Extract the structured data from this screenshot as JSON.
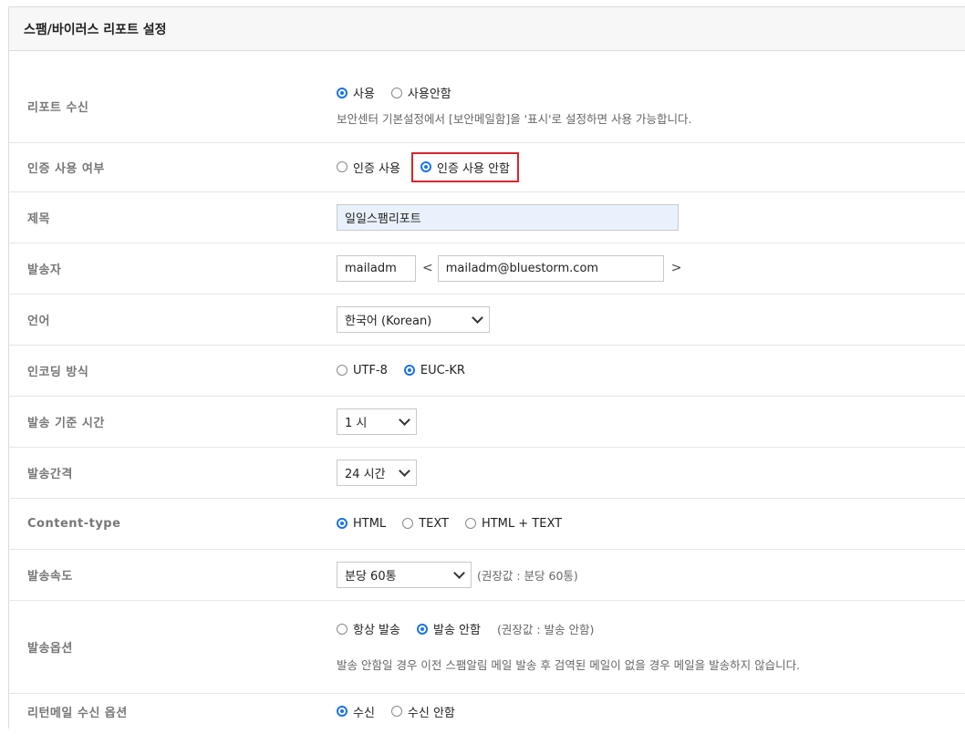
{
  "header": {
    "title": "스팸/바이러스 리포트 설정"
  },
  "rows": {
    "report_receive": {
      "label": "리포트 수신",
      "options": [
        "사용",
        "사용안함"
      ],
      "help": "보안센터 기본설정에서 [보안메일함]을 '표시'로 설정하면 사용 가능합니다."
    },
    "auth_use": {
      "label": "인증 사용 여부",
      "options": [
        "인증 사용",
        "인증 사용 안함"
      ]
    },
    "title": {
      "label": "제목",
      "value": "일일스팸리포트"
    },
    "sender": {
      "label": "발송자",
      "name": "mailadm",
      "lt": "<",
      "email": "mailadm@bluestorm.com",
      "gt": ">"
    },
    "language": {
      "label": "언어",
      "value": "한국어 (Korean)"
    },
    "encoding": {
      "label": "인코딩 방식",
      "options": [
        "UTF-8",
        "EUC-KR"
      ]
    },
    "send_time": {
      "label": "발송 기준 시간",
      "value": "1 시"
    },
    "send_interval": {
      "label": "발송간격",
      "value": "24 시간"
    },
    "content_type": {
      "label": "Content-type",
      "options": [
        "HTML",
        "TEXT",
        "HTML + TEXT"
      ]
    },
    "send_speed": {
      "label": "발송속도",
      "value": "분당 60통",
      "recommended": "(권장값 : 분당 60통)"
    },
    "send_option": {
      "label": "발송옵션",
      "options": [
        "항상 발송",
        "발송 안함"
      ],
      "recommended": "(권장값 : 발송 안함)",
      "help": "발송 안함일 경우 이전 스팸알림 메일 발송 후 검역된 메일이 없을 경우 메일을 발송하지 않습니다."
    },
    "return_mail": {
      "label": "리턴메일 수신 옵션",
      "options": [
        "수신",
        "수신 안함"
      ]
    }
  },
  "colors": {
    "accent": "#1a73e8",
    "highlight": "#d9262c",
    "title_input_bg": "#e9f2fc"
  }
}
